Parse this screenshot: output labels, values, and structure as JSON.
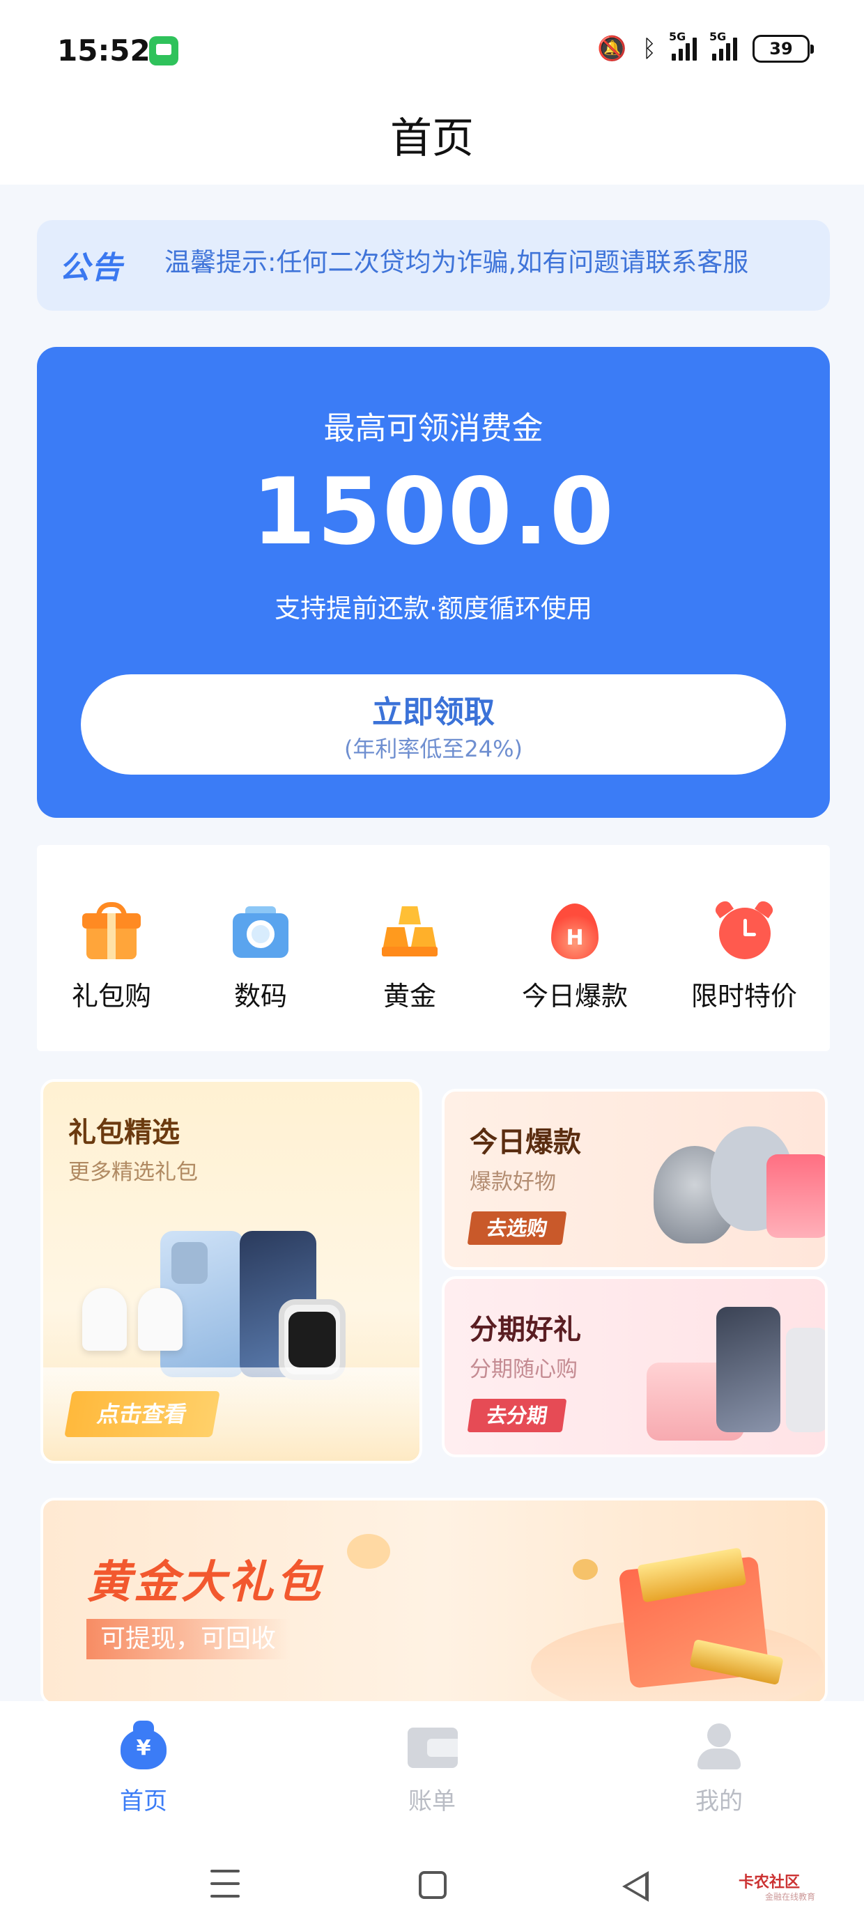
{
  "status_bar": {
    "time": "15:52",
    "battery": "39",
    "icons": [
      "message-icon",
      "mute-icon",
      "bluetooth-icon",
      "signal-5g-icon",
      "signal-5g-icon",
      "battery-icon"
    ]
  },
  "header": {
    "title": "首页"
  },
  "notice": {
    "tag": "公告",
    "text": "温馨提示:任何二次贷均为诈骗,如有问题请联系客服"
  },
  "hero": {
    "label": "最高可领消费金",
    "amount": "1500.0",
    "subtitle": "支持提前还款·额度循环使用",
    "button_label": "立即领取",
    "button_sub": "(年利率低至24%)",
    "color": "#3b7cf6"
  },
  "categories": [
    {
      "label": "礼包购",
      "icon": "gift-icon"
    },
    {
      "label": "数码",
      "icon": "camera-icon"
    },
    {
      "label": "黄金",
      "icon": "gold-bar-icon"
    },
    {
      "label": "今日爆款",
      "icon": "fire-icon"
    },
    {
      "label": "限时特价",
      "icon": "alarm-clock-icon"
    }
  ],
  "promos": {
    "gift": {
      "title": "礼包精选",
      "subtitle": "更多精选礼包",
      "button": "点击查看"
    },
    "hot": {
      "title": "今日爆款",
      "subtitle": "爆款好物",
      "button": "去选购"
    },
    "installment": {
      "title": "分期好礼",
      "subtitle": "分期随心购",
      "button": "去分期"
    },
    "gold": {
      "title": "黄金大礼包",
      "subtitle": "可提现，可回收"
    }
  },
  "tabbar": {
    "items": [
      {
        "label": "首页",
        "icon": "money-bag-icon",
        "active": true
      },
      {
        "label": "账单",
        "icon": "wallet-icon",
        "active": false
      },
      {
        "label": "我的",
        "icon": "person-icon",
        "active": false
      }
    ]
  },
  "watermark": {
    "text": "卡农社区",
    "sub": "金融在线教育"
  }
}
